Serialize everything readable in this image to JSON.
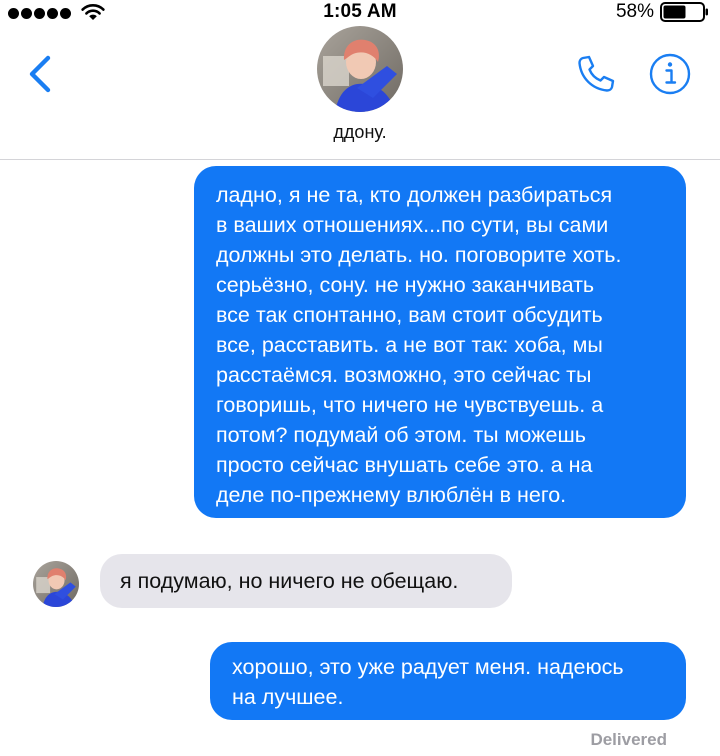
{
  "status_bar": {
    "time": "1:05 AM",
    "battery_percent": "58%",
    "battery_level": 0.58,
    "signal_bars": 5
  },
  "header": {
    "contact_name": "ддону.",
    "back_icon": "chevron-left-icon",
    "call_icon": "phone-icon",
    "info_icon": "info-icon"
  },
  "messages": [
    {
      "direction": "outgoing",
      "lines": [
        "ладно, я не та, кто должен разбираться",
        "в ваших отношениях...по сути, вы сами",
        "должны это делать. но. поговорите хоть.",
        "серьёзно, сону. не нужно заканчивать",
        "все так спонтанно, вам стоит обсудить",
        "все, расставить. а не вот так: хоба, мы",
        "расстаёмся. возможно, это сейчас ты",
        "говоришь, что ничего не чувствуешь. а",
        "потом? подумай об этом. ты можешь",
        "просто сейчас внушать себе это. а на",
        "деле по-прежнему влюблён в него."
      ]
    },
    {
      "direction": "incoming",
      "lines": [
        "я подумаю, но ничего не обещаю."
      ]
    },
    {
      "direction": "outgoing",
      "lines": [
        "хорошо, это уже радует меня. надеюсь",
        "на лучшее."
      ]
    }
  ],
  "delivered_label": "Delivered",
  "colors": {
    "accent": "#1a7ef2",
    "outgoing_bubble": "#1278f5",
    "incoming_bubble": "#e6e5eb",
    "delivered_text": "#9d9da3"
  }
}
